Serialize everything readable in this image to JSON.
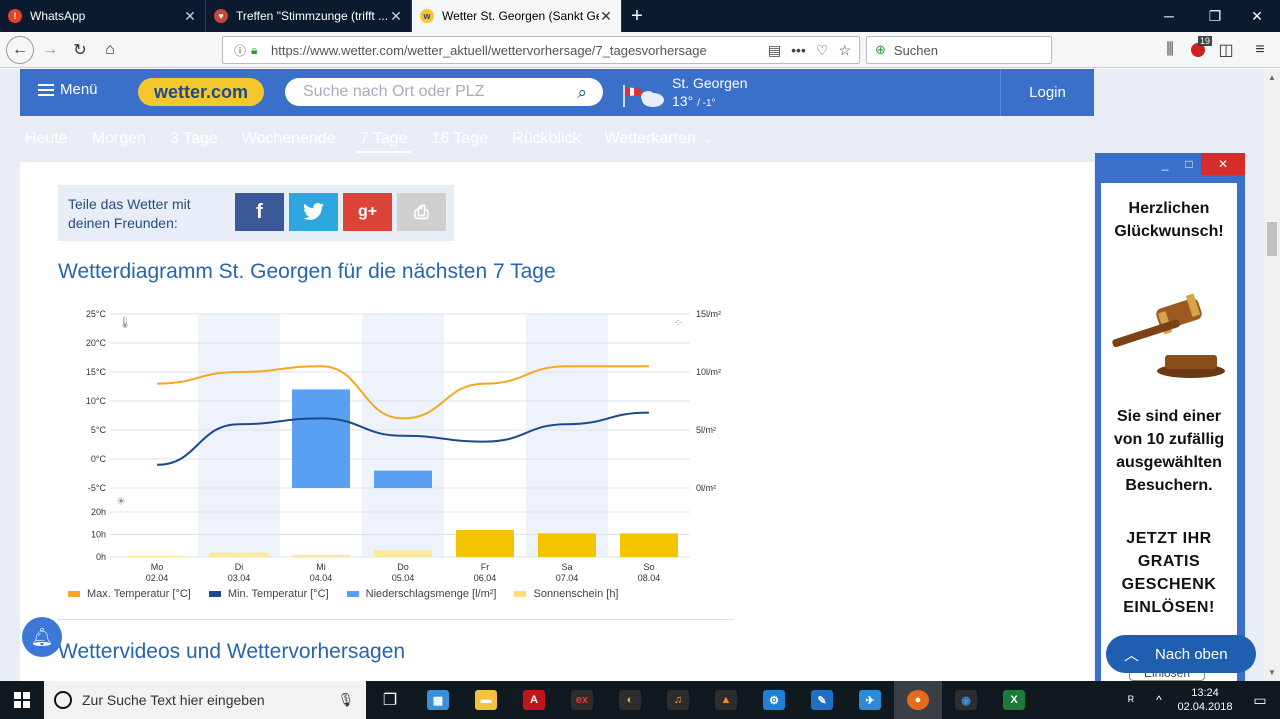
{
  "browser": {
    "tabs": [
      {
        "title": "WhatsApp",
        "favicon_color": "#e8412a",
        "favicon_glyph": "!"
      },
      {
        "title": "Treffen \"Stimmzunge (trifft ...",
        "favicon_color": "#d44",
        "favicon_glyph": "♥"
      },
      {
        "title": "Wetter St. Georgen (Sankt Geor",
        "favicon_color": "#f4c82c",
        "favicon_glyph": "w",
        "active": true
      }
    ],
    "new_tab": "+",
    "url": "https://www.wetter.com/wetter_aktuell/wettervorhersage/7_tagesvorhersage",
    "search_placeholder": "Suchen",
    "badge": "19"
  },
  "site": {
    "menu_label": "Menü",
    "logo": "wetter.com",
    "search_placeholder": "Suche nach Ort oder PLZ",
    "location_name": "St. Georgen",
    "location_temp": "13°",
    "location_temp_min": "/ -1°",
    "login": "Login",
    "nav": [
      "Heute",
      "Morgen",
      "3 Tage",
      "Wochenende",
      "7 Tage",
      "16 Tage",
      "Rückblick",
      "Wetterkarten"
    ],
    "nav_active": "7 Tage"
  },
  "share": {
    "label": "Teile das Wetter mit deinen Freunden:",
    "buttons": [
      {
        "name": "facebook",
        "glyph": "f",
        "color": "#3b5998"
      },
      {
        "name": "twitter",
        "glyph": "t",
        "color": "#2ea6e0"
      },
      {
        "name": "googleplus",
        "glyph": "g+",
        "color": "#db4437"
      },
      {
        "name": "print",
        "glyph": "⎙",
        "color": "#cfcfcf"
      }
    ]
  },
  "headings": {
    "diagram": "Wetterdiagramm St. Georgen für die nächsten 7 Tage",
    "videos": "Wettervideos und Wettervorhersagen"
  },
  "chart_data": {
    "type": "line+bar",
    "days": [
      "Mo",
      "Di",
      "Mi",
      "Do",
      "Fr",
      "Sa",
      "So"
    ],
    "dates": [
      "02.04",
      "03.04",
      "04.04",
      "05.04",
      "06.04",
      "07.04",
      "08.04"
    ],
    "temp_ticks": [
      "25°C",
      "20°C",
      "15°C",
      "10°C",
      "5°C",
      "0°C",
      "-5°C"
    ],
    "precip_ticks": [
      "15l/m²",
      "10l/m²",
      "5l/m²",
      "0l/m²"
    ],
    "sun_ticks": [
      "20h",
      "10h",
      "0h"
    ],
    "max_temp": [
      13,
      15,
      16,
      7,
      13,
      16,
      16
    ],
    "min_temp": [
      -1,
      6,
      7,
      4,
      3,
      6,
      8
    ],
    "precipitation": [
      0,
      0,
      8.5,
      1.5,
      0,
      0,
      0
    ],
    "sunshine": [
      0.5,
      2,
      1,
      3,
      12,
      10.5,
      10.5
    ],
    "temp_range": [
      -5,
      25
    ],
    "colors": {
      "max": "#f5a623",
      "min": "#1d4a8f",
      "precip": "#5aa0f2",
      "sun_low": "#fbe9a0",
      "sun_high": "#f5c400"
    },
    "legend": [
      "Max. Temperatur [°C]",
      "Min. Temperatur [°C]",
      "Niederschlagsmenge [l/m²]",
      "Sonnenschein [h]"
    ]
  },
  "ad": {
    "title": "Herzlichen Glückwunsch!",
    "body": "Sie sind einer von 10 zufällig ausgewählten Besuchern.",
    "cta": "JETZT IHR GRATIS GESCHENK EINLÖSEN!",
    "button": "Einlösen"
  },
  "nach_oben": "Nach oben",
  "taskbar": {
    "search_placeholder": "Zur Suche Text hier eingeben",
    "time": "13:24",
    "date": "02.04.2018"
  }
}
